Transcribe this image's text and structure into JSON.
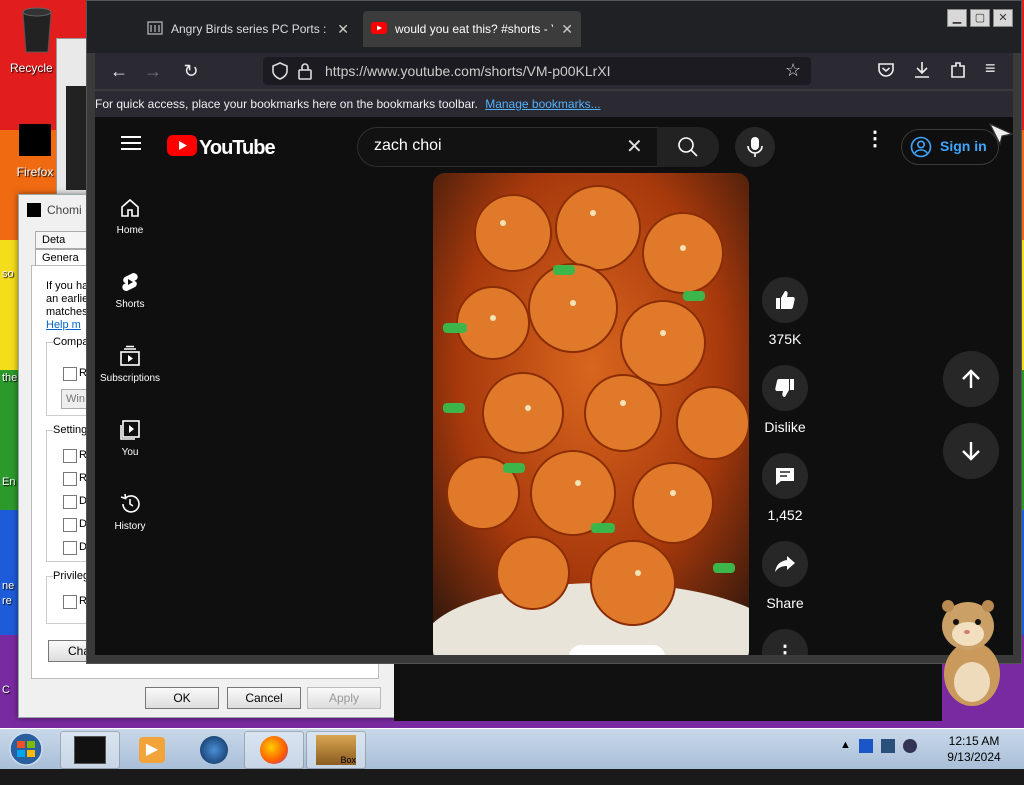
{
  "desktop": {
    "icons": [
      {
        "label": "Recycle B",
        "icon": "recycle-bin-icon"
      },
      {
        "label": "Firefox",
        "icon": "firefox-icon"
      }
    ],
    "edge_text": [
      "Fi",
      "so",
      "the",
      "En",
      "ne",
      "re",
      "C"
    ]
  },
  "dialog": {
    "title": "Chomi",
    "tabs": [
      "Deta",
      "Genera"
    ],
    "intro_lines": [
      "If you ha",
      "an earlie",
      "matches"
    ],
    "help_link": "Help m",
    "group_compat": "Compa",
    "compat_check": "R",
    "compat_select": "Win",
    "group_settings": "Setting",
    "settings_checks": [
      "R",
      "R",
      "D",
      "D",
      "D"
    ],
    "group_priv": "Privileg",
    "priv_check": "R",
    "change_btn": "Cha",
    "ok": "OK",
    "cancel": "Cancel",
    "apply": "Apply"
  },
  "browser": {
    "tabs": [
      {
        "title": "Angry Birds series PC Ports : Ro",
        "icon": "archive-icon",
        "active": false
      },
      {
        "title": "would you eat this? #shorts - Y",
        "icon": "youtube-icon",
        "active": true
      }
    ],
    "url": "https://www.youtube.com/shorts/VM-p00KLrXI",
    "bookmarks_text": "For quick access, place your bookmarks here on the bookmarks toolbar.",
    "bookmarks_link": "Manage bookmarks..."
  },
  "youtube": {
    "logo_text": "YouTube",
    "search_value": "zach choi",
    "signin": "Sign in",
    "sidebar": [
      {
        "label": "Home",
        "icon": "home-icon"
      },
      {
        "label": "Shorts",
        "icon": "shorts-icon"
      },
      {
        "label": "Subscriptions",
        "icon": "subscriptions-icon"
      },
      {
        "label": "You",
        "icon": "you-icon"
      },
      {
        "label": "History",
        "icon": "history-icon"
      }
    ],
    "actions": {
      "likes": "375K",
      "dislike": "Dislike",
      "comments": "1,452",
      "share": "Share"
    }
  },
  "taskbar": {
    "time": "12:15 AM",
    "date": "9/13/2024",
    "box_label": "Box"
  },
  "colors": {
    "youtube_red": "#ff0000",
    "signin_blue": "#3ea6ff",
    "link_blue": "#52b3ff"
  }
}
